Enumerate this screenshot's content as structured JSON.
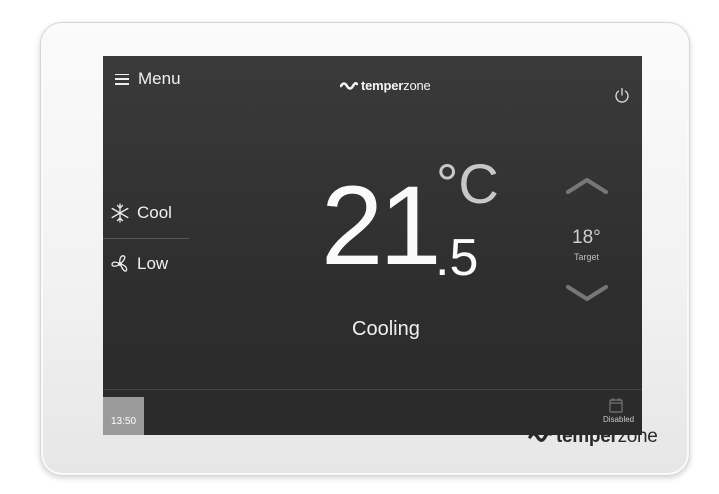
{
  "app": {
    "brand_bold": "temper",
    "brand_light": "zone"
  },
  "header": {
    "menu_label": "Menu",
    "menu_icon": "hamburger-icon",
    "power_icon": "power-icon"
  },
  "modes": {
    "mode_label": "Cool",
    "mode_icon": "snowflake-icon",
    "fan_label": "Low",
    "fan_icon": "fan-icon"
  },
  "temperature": {
    "whole": "21",
    "decimal": ".5",
    "unit": "°C",
    "status": "Cooling"
  },
  "target": {
    "value": "18°",
    "label": "Target",
    "up_icon": "chevron-up-icon",
    "down_icon": "chevron-down-icon"
  },
  "bottom": {
    "time": "13:50",
    "schedule_icon": "calendar-icon",
    "schedule_status": "Disabled"
  },
  "colors": {
    "screen_bg": "#333333",
    "bezel": "#f4f4f4",
    "text": "#f2f2f2",
    "clock_box": "#9b9b9b"
  }
}
